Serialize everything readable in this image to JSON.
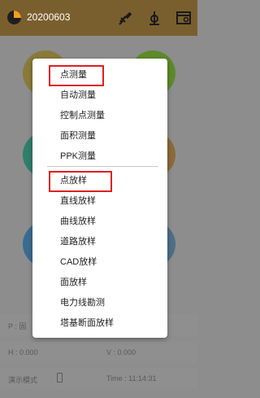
{
  "header": {
    "title": "20200603"
  },
  "colors": {
    "topbar": "#7a5f2e",
    "highlight": "#e01e1e"
  },
  "menu": {
    "items": [
      {
        "label": "点测量"
      },
      {
        "label": "自动测量"
      },
      {
        "label": "控制点测量"
      },
      {
        "label": "面积测量"
      },
      {
        "label": "PPK测量"
      },
      {
        "label": "点放样"
      },
      {
        "label": "直线放样"
      },
      {
        "label": "曲线放样"
      },
      {
        "label": "道路放样"
      },
      {
        "label": "CAD放样"
      },
      {
        "label": "面放样"
      },
      {
        "label": "电力线勘测"
      },
      {
        "label": "塔基断面放样"
      }
    ]
  },
  "status": {
    "solution_prefix": "P : 固",
    "h_label": "H : 0.000",
    "v_label": "V : 0.000",
    "mode": "演示模式",
    "time": "Time :  11:14:31"
  }
}
